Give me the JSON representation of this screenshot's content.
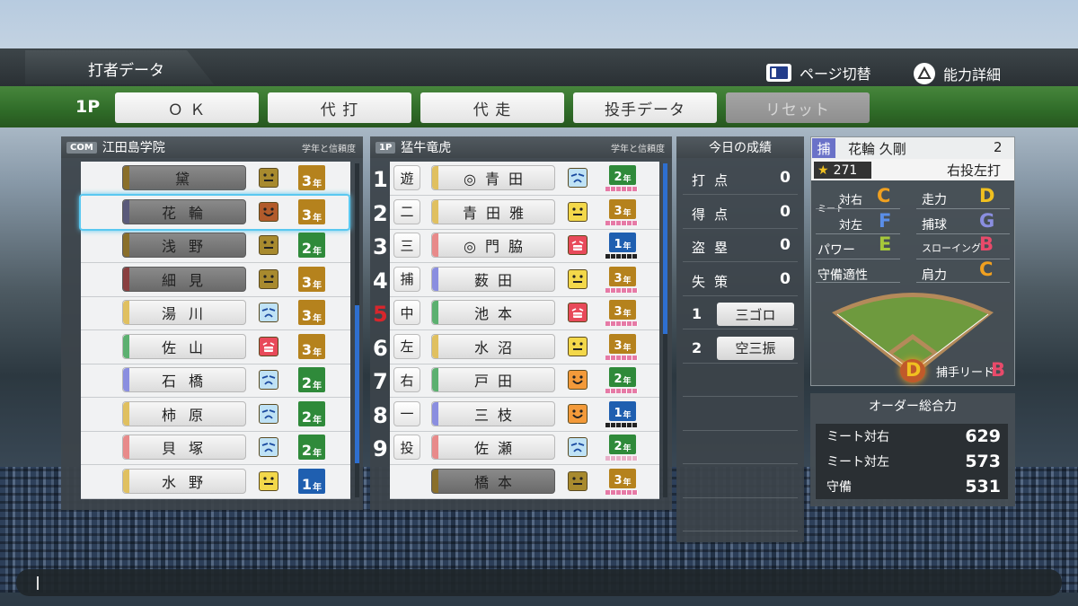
{
  "header": {
    "title": "打者データ",
    "hint_page": "ページ切替",
    "hint_detail": "能力詳細"
  },
  "toolbar": {
    "player": "1P",
    "ok": "Ｏ Ｋ",
    "pinch_hit": "代 打",
    "pinch_run": "代 走",
    "pitcher_data": "投手データ",
    "reset": "リセット"
  },
  "left": {
    "tag": "COM",
    "team": "江田島学院",
    "col_header": "学年と信頼度",
    "players": [
      {
        "name": "黛",
        "color": "#8a6f2a",
        "active": false,
        "face": "neutral",
        "face_color": "#a88a2e",
        "grade": "3",
        "gcolor": "#b5821d"
      },
      {
        "name": "花輪",
        "color": "#5a5a7a",
        "active": false,
        "face": "happy",
        "face_color": "#b25b2b",
        "grade": "3",
        "gcolor": "#b5821d",
        "selected": true
      },
      {
        "name": "浅野",
        "color": "#8a6f2a",
        "active": false,
        "face": "neutral",
        "face_color": "#a88a2e",
        "grade": "2",
        "gcolor": "#2f8a3a"
      },
      {
        "name": "細見",
        "color": "#8a3f3f",
        "active": false,
        "face": "neutral",
        "face_color": "#a88a2e",
        "grade": "3",
        "gcolor": "#b5821d"
      },
      {
        "name": "湯川",
        "color": "#e0c060",
        "active": true,
        "face": "sad",
        "face_color": "#bfe2f5",
        "grade": "3",
        "gcolor": "#b5821d"
      },
      {
        "name": "佐山",
        "color": "#5cb070",
        "active": true,
        "face": "laugh",
        "face_color": "#e84a5a",
        "grade": "3",
        "gcolor": "#b5821d"
      },
      {
        "name": "石橋",
        "color": "#8a8ee0",
        "active": true,
        "face": "sad",
        "face_color": "#bfe2f5",
        "grade": "2",
        "gcolor": "#2f8a3a"
      },
      {
        "name": "柿原",
        "color": "#e0c060",
        "active": true,
        "face": "sad",
        "face_color": "#bfe2f5",
        "grade": "2",
        "gcolor": "#2f8a3a"
      },
      {
        "name": "貝塚",
        "color": "#e88a8a",
        "active": true,
        "face": "sad",
        "face_color": "#bfe2f5",
        "grade": "2",
        "gcolor": "#2f8a3a"
      },
      {
        "name": "水野",
        "color": "#e0c060",
        "active": true,
        "face": "neutral",
        "face_color": "#f3d84a",
        "grade": "1",
        "gcolor": "#1f5fb0"
      }
    ]
  },
  "right": {
    "tag": "1P",
    "team": "猛牛竜虎",
    "col_header": "学年と信頼度",
    "players": [
      {
        "no": "1",
        "pos": "遊",
        "name": "◎青田",
        "color": "#e0c060",
        "face": "sad",
        "face_color": "#bfe2f5",
        "grade": "2",
        "gcolor": "#2f8a3a",
        "bar": "p"
      },
      {
        "no": "2",
        "pos": "二",
        "name": "青田雅",
        "color": "#e0c060",
        "face": "neutral",
        "face_color": "#f3d84a",
        "grade": "3",
        "gcolor": "#b5821d",
        "bar": "p"
      },
      {
        "no": "3",
        "pos": "三",
        "name": "◎門脇",
        "color": "#e88a8a",
        "face": "laugh",
        "face_color": "#e84a5a",
        "grade": "1",
        "gcolor": "#1f5fb0",
        "bar": "d"
      },
      {
        "no": "4",
        "pos": "捕",
        "name": "薮田",
        "color": "#8a8ee0",
        "face": "neutral",
        "face_color": "#f3d84a",
        "grade": "3",
        "gcolor": "#b5821d",
        "bar": "p"
      },
      {
        "no": "5",
        "pos": "中",
        "name": "池本",
        "color": "#5cb070",
        "face": "laugh",
        "face_color": "#e84a5a",
        "grade": "3",
        "gcolor": "#b5821d",
        "bar": "p",
        "red": true
      },
      {
        "no": "6",
        "pos": "左",
        "name": "水沼",
        "color": "#e0c060",
        "face": "neutral",
        "face_color": "#f3d84a",
        "grade": "3",
        "gcolor": "#b5821d",
        "bar": "p"
      },
      {
        "no": "7",
        "pos": "右",
        "name": "戸田",
        "color": "#5cb070",
        "face": "happy",
        "face_color": "#f39a3a",
        "grade": "2",
        "gcolor": "#2f8a3a",
        "bar": "p"
      },
      {
        "no": "8",
        "pos": "一",
        "name": "三枝",
        "color": "#8a8ee0",
        "face": "happy",
        "face_color": "#f39a3a",
        "grade": "1",
        "gcolor": "#1f5fb0",
        "bar": "d"
      },
      {
        "no": "9",
        "pos": "投",
        "name": "佐瀬",
        "color": "#e88a8a",
        "face": "sad",
        "face_color": "#bfe2f5",
        "grade": "2",
        "gcolor": "#2f8a3a",
        "bar": "m"
      },
      {
        "no": "",
        "pos": "",
        "name": "橋本",
        "color": "#8a6f2a",
        "face": "neutral",
        "face_color": "#a88a2e",
        "grade": "3",
        "gcolor": "#b5821d",
        "bar": "p",
        "inactive": true
      }
    ]
  },
  "today": {
    "title": "今日の成績",
    "stats": [
      {
        "label": "打点",
        "value": "0"
      },
      {
        "label": "得点",
        "value": "0"
      },
      {
        "label": "盗塁",
        "value": "0"
      },
      {
        "label": "失策",
        "value": "0"
      }
    ],
    "results": [
      {
        "no": "1",
        "text": "三ゴロ"
      },
      {
        "no": "2",
        "text": "空三振"
      }
    ]
  },
  "detail": {
    "pos": "捕",
    "name": "花輪 久剛",
    "grade": "2",
    "stars": "271",
    "hand": "右投左打",
    "meet_label": "ミート",
    "vs_right": "対右",
    "vs_right_grade": "C",
    "vs_left": "対左",
    "vs_left_grade": "F",
    "power": "パワー",
    "power_grade": "E",
    "speed": "走力",
    "speed_grade": "D",
    "catch": "捕球",
    "catch_grade": "G",
    "throw": "スローイング",
    "throw_grade": "B",
    "fitness": "守備適性",
    "arm": "肩力",
    "arm_grade": "C",
    "catcher_grade": "D",
    "lead": "捕手リード",
    "lead_grade": "B"
  },
  "order": {
    "title": "オーダー総合力",
    "rows": [
      {
        "label": "ミート対右",
        "value": "629"
      },
      {
        "label": "ミート対左",
        "value": "573"
      },
      {
        "label": "守備",
        "value": "531"
      }
    ]
  },
  "colors": {
    "C": "#f0a020",
    "F": "#5a8ee8",
    "E": "#a6c83a",
    "D": "#f0c020",
    "G": "#8a8ee0",
    "B": "#e84a6a"
  }
}
